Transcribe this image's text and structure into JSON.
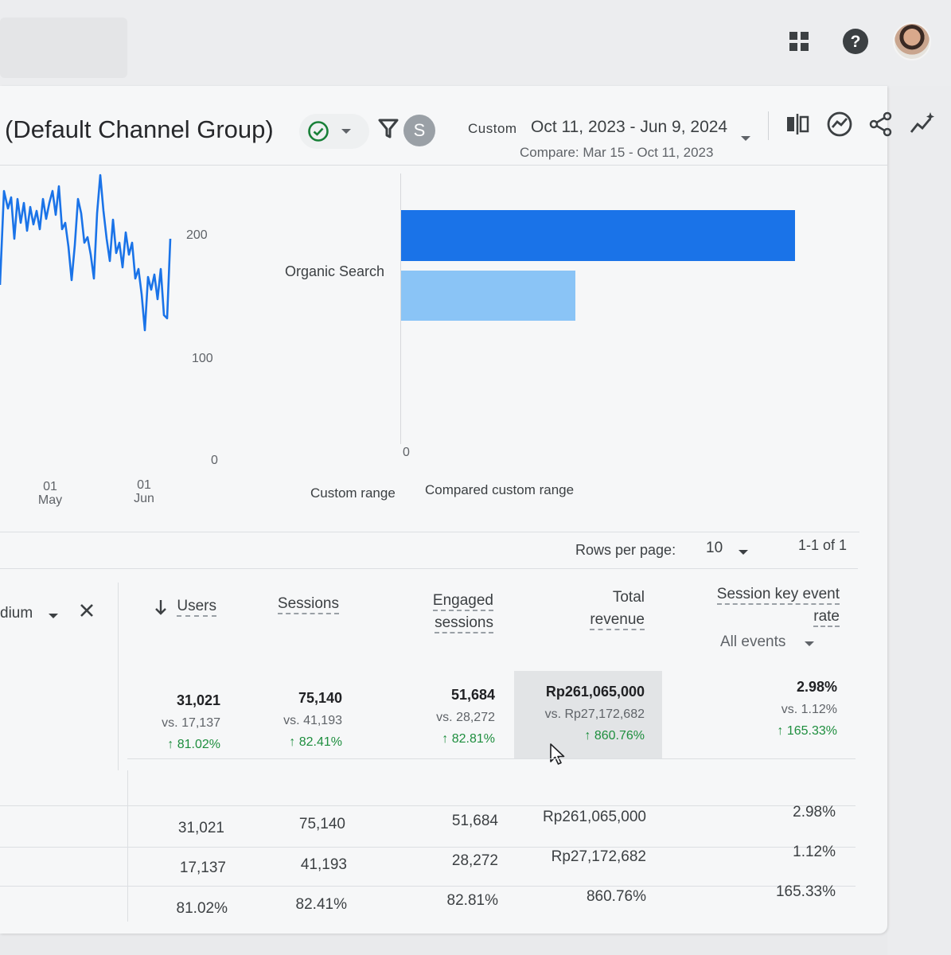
{
  "header": {
    "report_title": "(Default Channel Group)",
    "segment_initial": "S",
    "date_preset": "Custom",
    "date_range": "Oct 11, 2023 - Jun 9, 2024",
    "compare_range": "Compare: Mar 15 - Oct 11, 2023",
    "icons": [
      "check-circle-icon",
      "chevron-down-icon",
      "filter-icon",
      "compare-icon",
      "insights-icon",
      "share-icon",
      "sparkle-trend-icon"
    ]
  },
  "topbar": {
    "icons": [
      "apps-grid-icon",
      "help-icon",
      "avatar"
    ]
  },
  "line_chart": {
    "y_ticks": [
      "200",
      "100",
      "0"
    ],
    "x_ticks": [
      {
        "day": "01",
        "month": "May"
      },
      {
        "day": "01",
        "month": "Jun"
      }
    ],
    "color": "#1a73e8"
  },
  "bar_chart": {
    "category": "Organic Search",
    "zero_label": "0",
    "legend": [
      "Custom range",
      "Compared custom range"
    ],
    "colors": {
      "primary": "#1a73e8",
      "compare": "#8ac4f6"
    }
  },
  "chart_data": [
    {
      "type": "bar",
      "categories": [
        "Organic Search"
      ],
      "series": [
        {
          "name": "Custom range",
          "values": [
            31021
          ]
        },
        {
          "name": "Compared custom range",
          "values": [
            17137
          ]
        }
      ],
      "xlim": [
        0,
        31021
      ]
    }
  ],
  "table": {
    "rows_per_page_label": "Rows per page:",
    "rows_per_page": "10",
    "pagination": "1-1 of 1",
    "dimension_partial": "dium",
    "columns": {
      "users": "Users",
      "sessions": "Sessions",
      "engaged_l1": "Engaged",
      "engaged_l2": "sessions",
      "revenue_l1": "Total",
      "revenue_l2": "revenue",
      "keyrate_l1": "Session key event",
      "keyrate_l2": "rate",
      "all_events": "All events"
    },
    "totals": {
      "users": {
        "value": "31,021",
        "vs": "vs. 17,137",
        "change": "81.02%"
      },
      "sessions": {
        "value": "75,140",
        "vs": "vs. 41,193",
        "change": "82.41%"
      },
      "engaged": {
        "value": "51,684",
        "vs": "vs. 28,272",
        "change": "82.81%"
      },
      "revenue": {
        "value": "Rp261,065,000",
        "vs": "vs. Rp27,172,682",
        "change": "860.76%"
      },
      "keyrate": {
        "value": "2.98%",
        "vs": "vs. 1.12%",
        "change": "165.33%"
      }
    },
    "rows": [
      [
        "31,021",
        "75,140",
        "51,684",
        "Rp261,065,000",
        "2.98%"
      ],
      [
        "17,137",
        "41,193",
        "28,272",
        "Rp27,172,682",
        "1.12%"
      ],
      [
        "81.02%",
        "82.41%",
        "82.81%",
        "860.76%",
        "165.33%"
      ]
    ]
  }
}
